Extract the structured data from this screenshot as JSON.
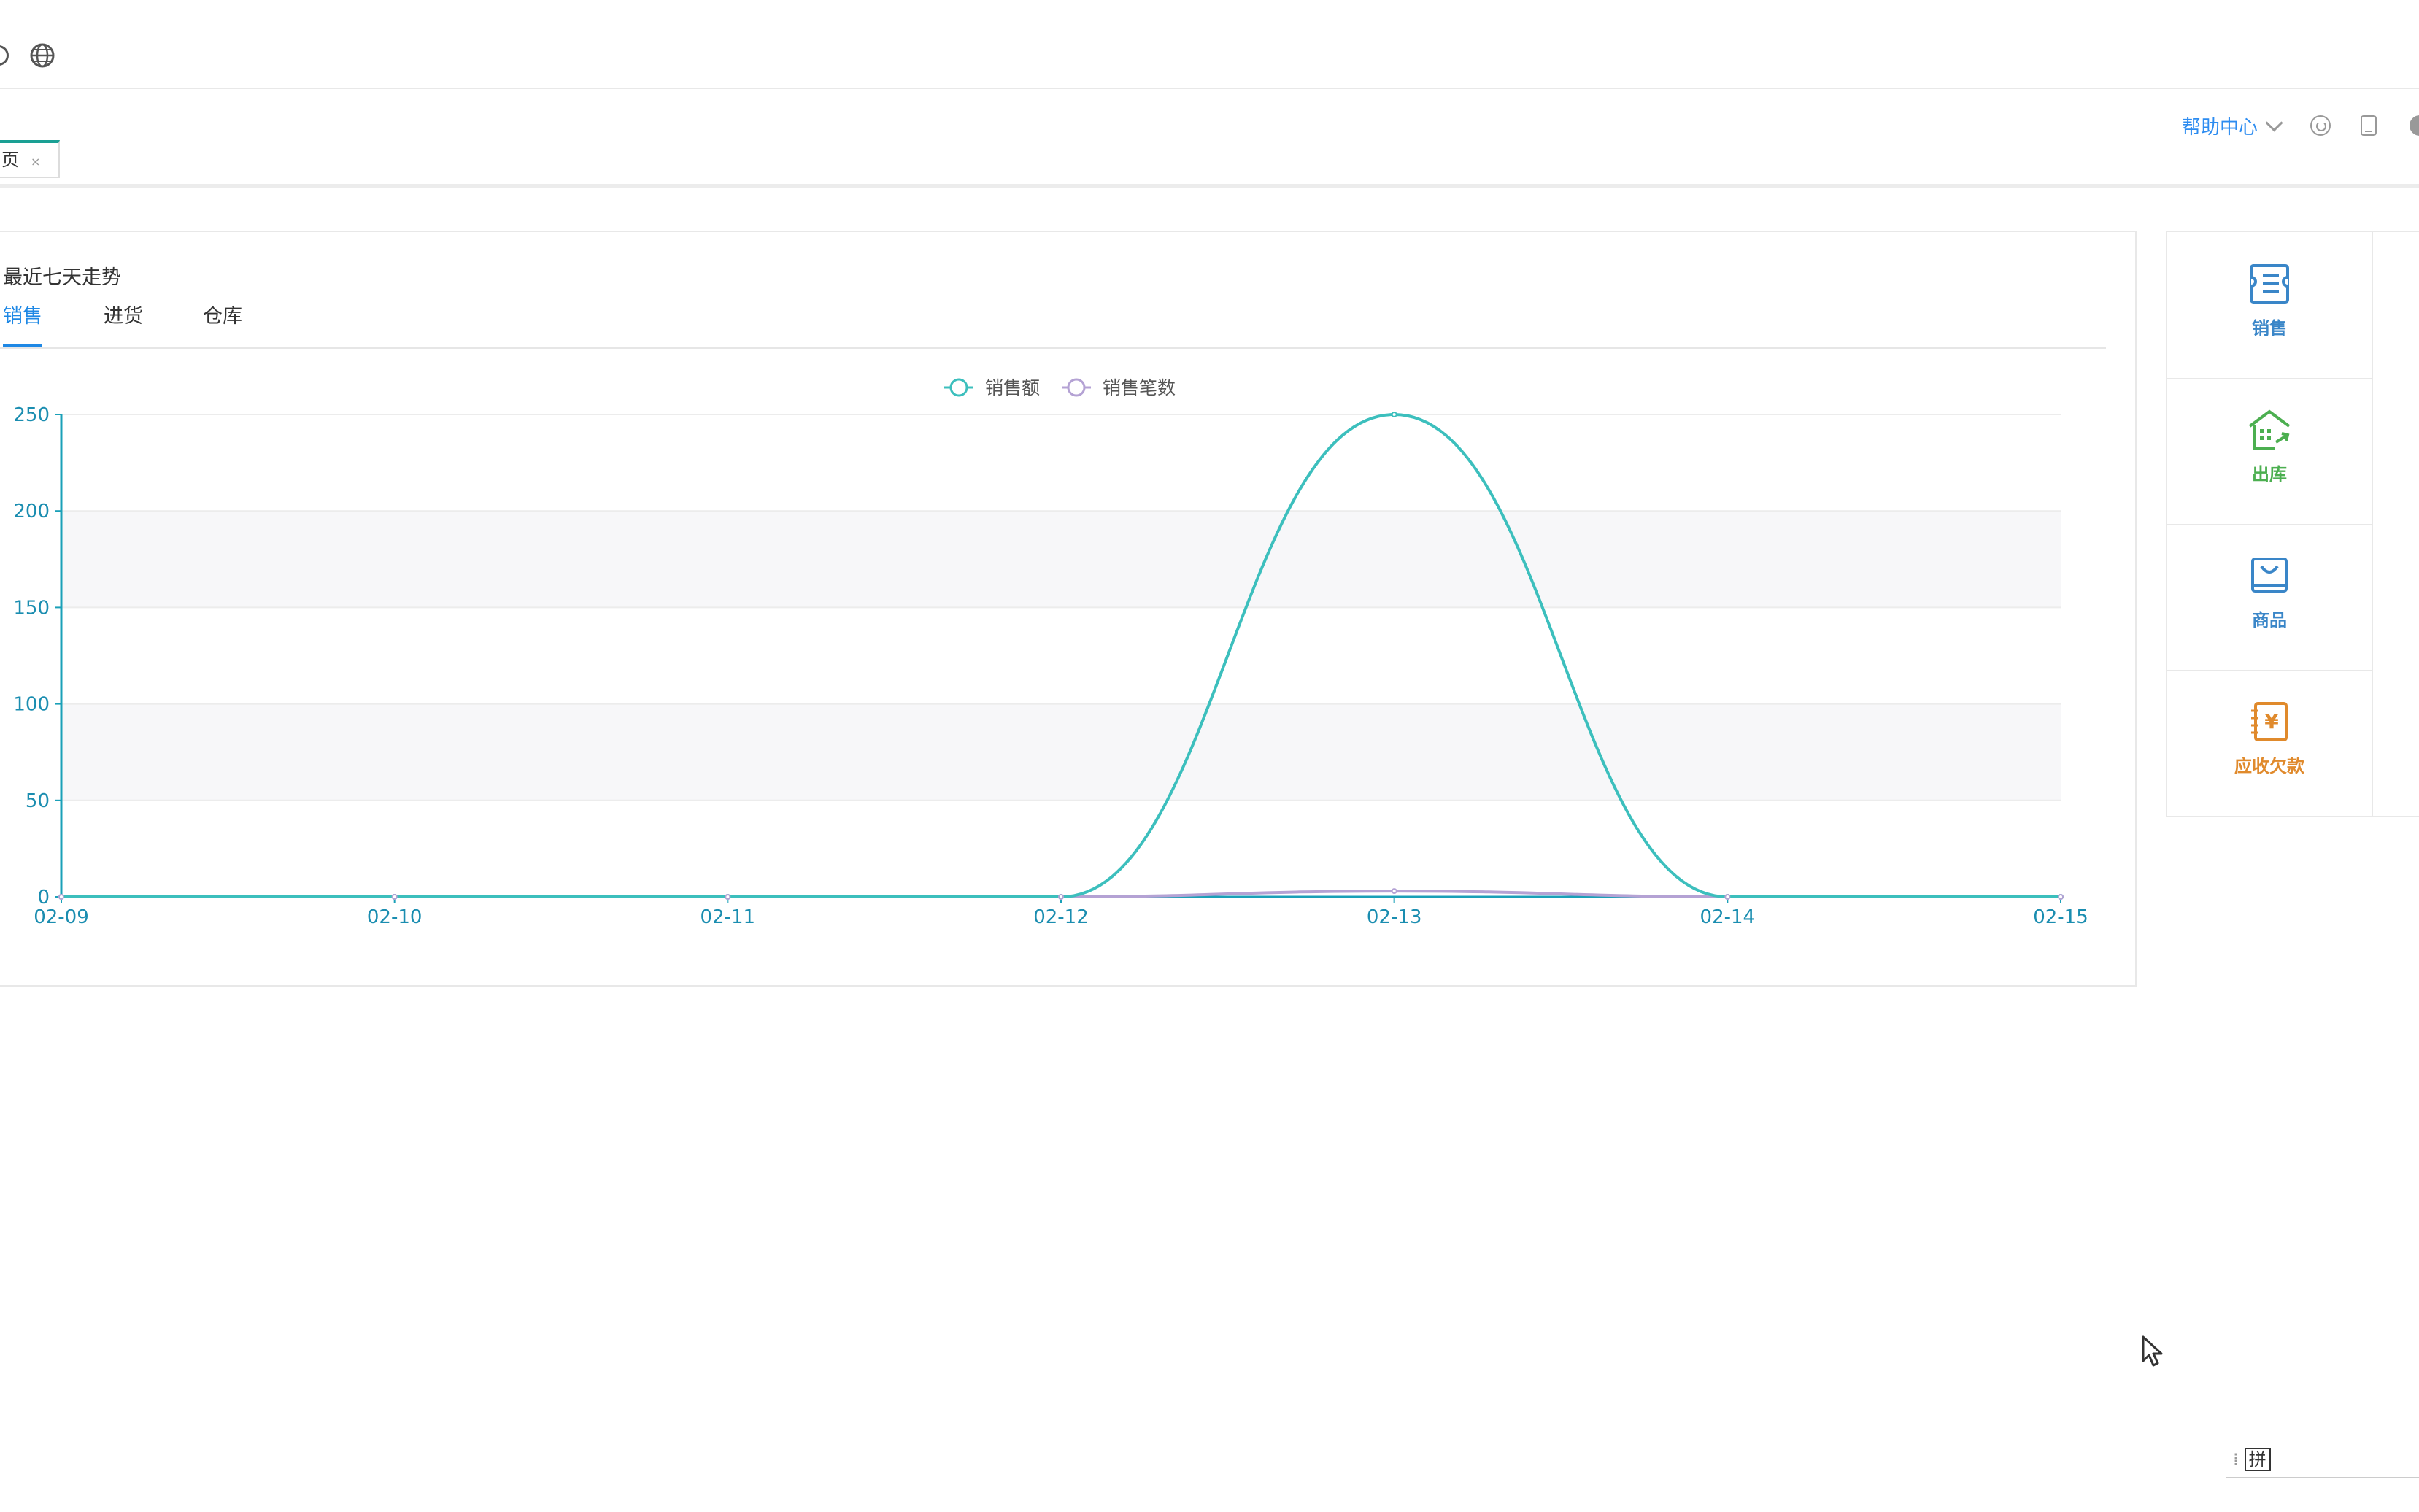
{
  "topbar": {},
  "tabs": {
    "home_label": "页",
    "close_glyph": "×"
  },
  "header_tools": {
    "help_label": "帮助中心"
  },
  "panel": {
    "title": "最近七天走势",
    "tabs": [
      "销售",
      "进货",
      "仓库"
    ],
    "active_tab": 0
  },
  "chart_data": {
    "type": "line",
    "x": [
      "02-09",
      "02-10",
      "02-11",
      "02-12",
      "02-13",
      "02-14",
      "02-15"
    ],
    "series": [
      {
        "name": "销售额",
        "values": [
          0,
          0,
          0,
          0,
          250,
          0,
          0
        ],
        "color": "#3cbfbd"
      },
      {
        "name": "销售笔数",
        "values": [
          0,
          0,
          0,
          0,
          3,
          0,
          0
        ],
        "color": "#b4a2d4"
      }
    ],
    "y_ticks": [
      0,
      50,
      100,
      150,
      200,
      250
    ],
    "ylim": [
      0,
      250
    ],
    "smooth": true,
    "legend_position": "top-center",
    "grid": true
  },
  "shortcuts": [
    {
      "label": "销售",
      "icon": "sales-icon",
      "color": "#3a86c8"
    },
    {
      "label": "出库",
      "icon": "warehouse-out-icon",
      "color": "#4caf50"
    },
    {
      "label": "商品",
      "icon": "goods-icon",
      "color": "#3a86c8"
    },
    {
      "label": "应收欠款",
      "icon": "receivable-icon",
      "color": "#e08a2c"
    }
  ],
  "ime": {
    "label": "拼"
  }
}
